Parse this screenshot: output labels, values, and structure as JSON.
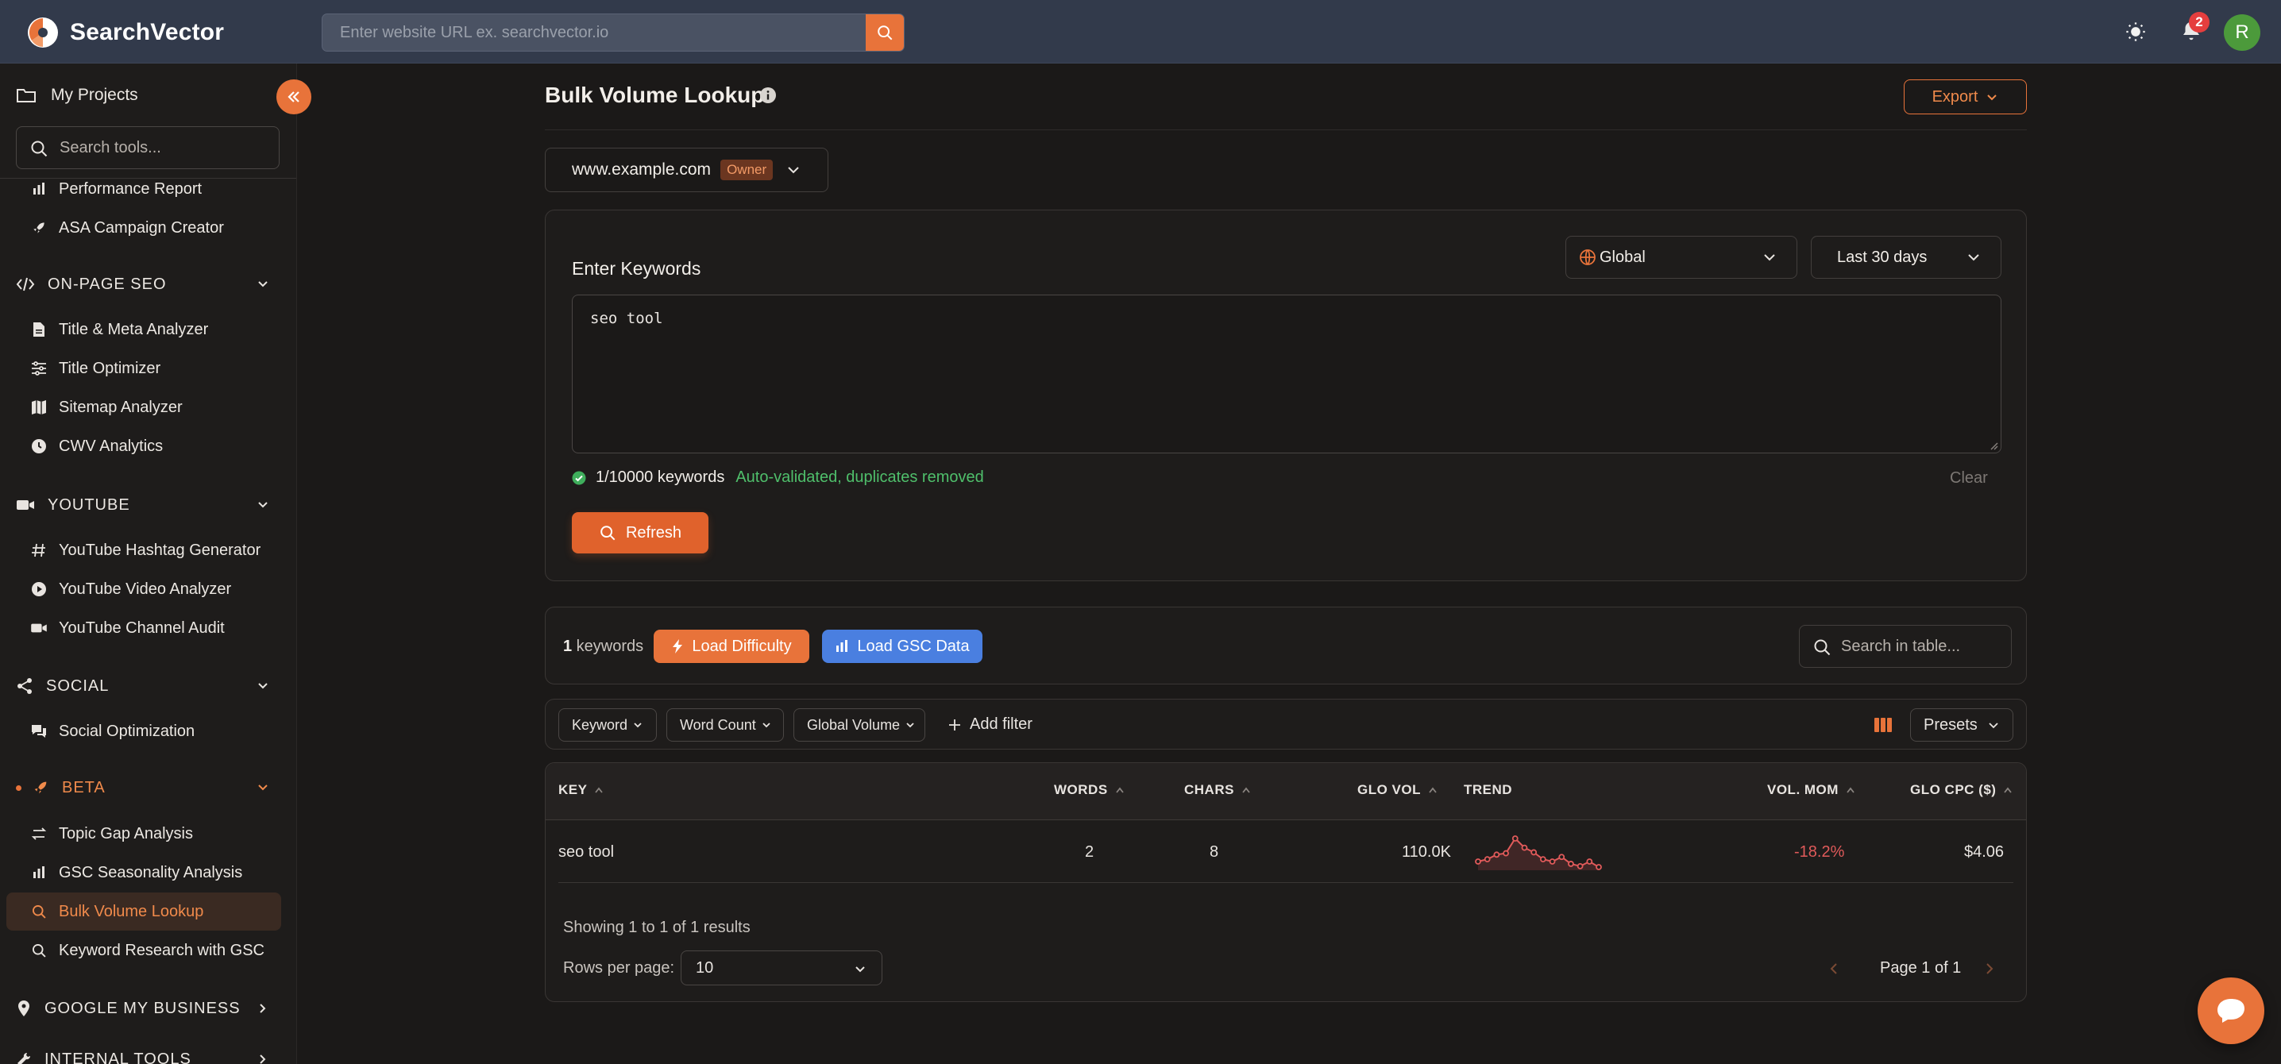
{
  "app": {
    "name": "SearchVector",
    "url_placeholder": "Enter website URL ex. searchvector.io",
    "notifications_count": "2",
    "avatar_initial": "R",
    "accent_color": "#e8733a"
  },
  "sidebar": {
    "projects_label": "My Projects",
    "search_placeholder": "Search tools...",
    "items_top": [
      {
        "label": "Performance Report",
        "icon": "bar-chart-icon"
      },
      {
        "label": "ASA Campaign Creator",
        "icon": "rocket-icon"
      }
    ],
    "sections": {
      "onpage": {
        "label": "ON-PAGE SEO",
        "items": [
          "Title & Meta Analyzer",
          "Title Optimizer",
          "Sitemap Analyzer",
          "CWV Analytics"
        ]
      },
      "youtube": {
        "label": "YOUTUBE",
        "items": [
          "YouTube Hashtag Generator",
          "YouTube Video Analyzer",
          "YouTube Channel Audit"
        ]
      },
      "social": {
        "label": "SOCIAL",
        "items": [
          "Social Optimization"
        ]
      },
      "beta": {
        "label": "BETA",
        "items": [
          "Topic Gap Analysis",
          "GSC Seasonality Analysis",
          "Bulk Volume Lookup",
          "Keyword Research with GSC"
        ]
      },
      "gmb": {
        "label": "GOOGLE MY BUSINESS"
      },
      "internal": {
        "label": "INTERNAL TOOLS"
      }
    }
  },
  "page": {
    "title": "Bulk Volume Lookup",
    "export_label": "Export",
    "domain": "www.example.com",
    "domain_badge": "Owner",
    "enter_keywords_label": "Enter Keywords",
    "location": "Global",
    "period": "Last 30 days",
    "keywords_text": "seo tool",
    "keyword_count": "1/10000 keywords",
    "validation_note": "Auto-validated, duplicates removed",
    "clear_label": "Clear",
    "refresh_label": "Refresh"
  },
  "actions": {
    "count_number": "1",
    "count_suffix": " keywords",
    "load_difficulty_label": "Load Difficulty",
    "load_gsc_label": "Load GSC Data",
    "table_search_placeholder": "Search in table..."
  },
  "filters": {
    "chips": [
      "Keyword",
      "Word Count",
      "Global Volume"
    ],
    "add_filter_label": "Add filter",
    "presets_label": "Presets"
  },
  "table": {
    "headers": {
      "key": "KEY",
      "words": "WORDS",
      "chars": "CHARS",
      "glo_vol": "GLO VOL",
      "trend": "TREND",
      "vol_mom": "VOL. MOM",
      "glo_cpc": "GLO CPC ($)"
    },
    "rows": [
      {
        "key": "seo tool",
        "words": "2",
        "chars": "8",
        "glo_vol": "110.0K",
        "trend": [
          3,
          3.5,
          4.5,
          4.8,
          8,
          6,
          5,
          3.5,
          3,
          4,
          2.5,
          2,
          3,
          1.8
        ],
        "vol_mom": "-18.2%",
        "glo_cpc": "$4.06"
      }
    ],
    "showing_text": "Showing 1 to 1 of 1 results",
    "rows_per_page_label": "Rows per page:",
    "rows_per_page_value": "10",
    "page_text": "Page 1 of 1"
  }
}
